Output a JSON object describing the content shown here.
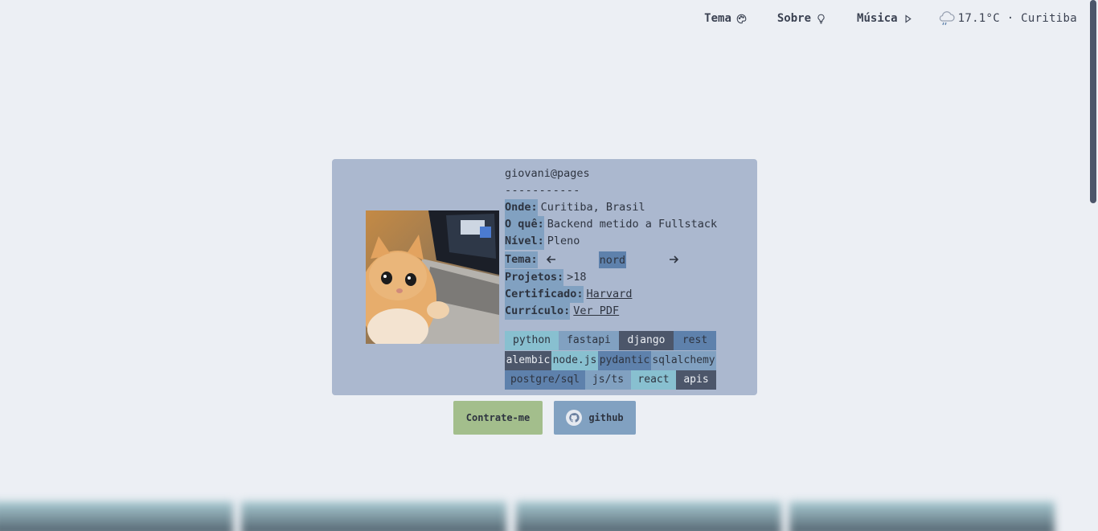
{
  "nav": {
    "theme_label": "Tema",
    "about_label": "Sobre",
    "music_label": "Música",
    "weather_text": "17.1°C · Curitiba"
  },
  "profile": {
    "handle": "giovani@pages",
    "divider": "-----------",
    "fields": {
      "where_label": "Onde:",
      "where_value": "Curitiba, Brasil",
      "what_label": "O quê:",
      "what_value": "Backend metido a Fullstack",
      "level_label": "Nível:",
      "level_value": "Pleno",
      "theme_label": "Tema:",
      "theme_value": "nord",
      "projects_label": "Projetos:",
      "projects_value": ">18",
      "cert_label": "Certificado:",
      "cert_value": "Harvard",
      "cv_label": "Currículo:",
      "cv_value": "Ver PDF"
    }
  },
  "tags": [
    [
      "python",
      "fastapi",
      "django",
      "rest"
    ],
    [
      "alembic",
      "node.js",
      "pydantic",
      "sqlalchemy"
    ],
    [
      "postgre/sql",
      "js/ts",
      "react",
      "apis"
    ]
  ],
  "buttons": {
    "hire_label": "Contrate-me",
    "github_label": "github"
  },
  "colors": {
    "background": "#eceff4",
    "card": "#abb8cf",
    "accent_teal": "#88c0d0",
    "accent_blue": "#81a1c1",
    "accent_navy": "#5e81ac",
    "accent_dark": "#4c566a",
    "hire_green": "#a3be8c"
  },
  "icons": [
    "palette-icon",
    "lightbulb-icon",
    "play-icon",
    "rain-cloud-icon",
    "arrow-left-icon",
    "arrow-right-icon",
    "github-icon"
  ]
}
